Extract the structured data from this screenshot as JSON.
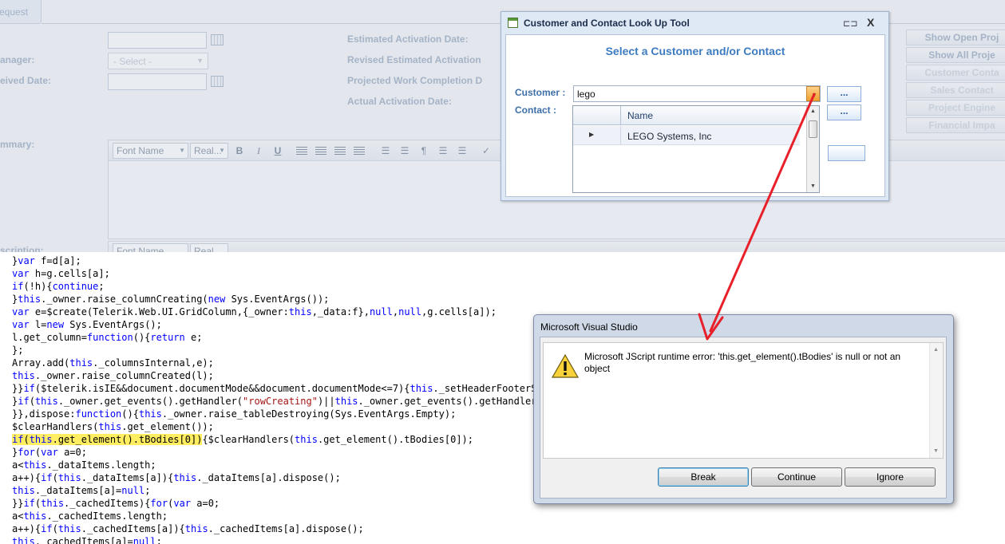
{
  "webapp": {
    "tab_request": "equest",
    "labels": {
      "manager": "anager:",
      "received_date": "eived Date:",
      "summary": "mmary:",
      "description": "scription:",
      "estimated_activation": "Estimated Activation Date:",
      "revised_activation": "Revised Estimated Activation",
      "projected_completion": "Projected Work Completion D",
      "actual_activation": "Actual Activation Date:"
    },
    "select_placeholder": "- Select -",
    "right_buttons": [
      "Show Open Proj",
      "Show All Proje",
      "Customer Conta",
      "Sales Contact",
      "Project Engine",
      "Financial Impa"
    ],
    "editor_toolbar": {
      "font_name": "Font Name",
      "font_size": "Real...",
      "bold": "B",
      "italic": "I",
      "underline": "U"
    }
  },
  "lookup": {
    "title": "Customer and Contact Look Up Tool",
    "pin_icon": "pin-icon",
    "close": "X",
    "heading": "Select a Customer and/or Contact",
    "customer_label": "Customer :",
    "customer_value": "lego",
    "contact_label": "Contact :",
    "ellipsis": "...",
    "grid": {
      "column_name": "Name",
      "rows": [
        {
          "indicator": "▶",
          "name": "LEGO Systems, Inc"
        }
      ]
    }
  },
  "code": {
    "lines": [
      "}var f=d[a];",
      "var h=g.cells[a];",
      "if(!h){continue;",
      "}this._owner.raise_columnCreating(new Sys.EventArgs());",
      "var e=$create(Telerik.Web.UI.GridColumn,{_owner:this,_data:f},null,null,g.cells[a]);",
      "var l=new Sys.EventArgs();",
      "l.get_column=function(){return e;",
      "};",
      "Array.add(this._columnsInternal,e);",
      "this._owner.raise_columnCreated(l);",
      "}}if($telerik.isIE&&document.documentMode&&document.documentMode<=7){this._setHeaderFooterSpan",
      "}if(this._owner.get_events().getHandler(\"rowCreating\")||this._owner.get_events().getHandler(\"",
      "}},dispose:function(){this._owner.raise_tableDestroying(Sys.EventArgs.Empty);",
      "$clearHandlers(this.get_element());",
      "if(this.get_element().tBodies[0]){$clearHandlers(this.get_element().tBodies[0]);",
      "}for(var a=0;",
      "a<this._dataItems.length;",
      "a++){if(this._dataItems[a]){this._dataItems[a].dispose();",
      "this._dataItems[a]=null;",
      "}}if(this._cachedItems){for(var a=0;",
      "a<this._cachedItems.length;",
      "a++){if(this._cachedItems[a]){this._cachedItems[a].dispose();",
      "this._cachedItems[a]=null;"
    ],
    "highlighted_text": "if(this.get_element().tBodies[0])"
  },
  "vs_dialog": {
    "title": "Microsoft Visual Studio",
    "message": "Microsoft JScript runtime error: 'this.get_element().tBodies' is null or not an object",
    "icon": "warning-icon",
    "buttons": {
      "break": "Break",
      "continue": "Continue",
      "ignore": "Ignore"
    }
  },
  "annotation": {
    "arrow_color": "#e8202a"
  },
  "colors": {
    "heading_blue": "#3e7cc2",
    "highlight": "#ffee62"
  }
}
